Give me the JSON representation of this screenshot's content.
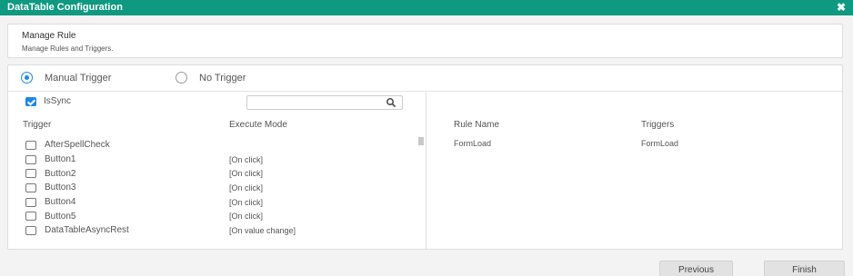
{
  "dialog": {
    "title": "DataTable Configuration",
    "close": "✖"
  },
  "rule": {
    "heading": "Manage Rule",
    "subheading": "Manage Rules and Triggers."
  },
  "trigger_type": {
    "options": [
      {
        "label": "Manual Trigger",
        "selected": true
      },
      {
        "label": "No Trigger",
        "selected": false
      }
    ]
  },
  "sync": {
    "label": "IsSync",
    "checked": true
  },
  "search": {
    "value": "",
    "placeholder": ""
  },
  "trigger_table": {
    "headers": {
      "trigger": "Trigger",
      "mode": "Execute Mode"
    },
    "rows": [
      {
        "name": "AfterSpellCheck",
        "mode": "",
        "checked": false
      },
      {
        "name": "Button1",
        "mode": "[On click]",
        "checked": false
      },
      {
        "name": "Button2",
        "mode": "[On click]",
        "checked": false
      },
      {
        "name": "Button3",
        "mode": "[On click]",
        "checked": false
      },
      {
        "name": "Button4",
        "mode": "[On click]",
        "checked": false
      },
      {
        "name": "Button5",
        "mode": "[On click]",
        "checked": false
      },
      {
        "name": "DataTableAsyncRest",
        "mode": "[On value change]",
        "checked": false
      }
    ]
  },
  "rules_table": {
    "headers": {
      "rule_name": "Rule Name",
      "triggers": "Triggers"
    },
    "rows": [
      {
        "rule_name": "FormLoad",
        "triggers": "FormLoad"
      }
    ]
  },
  "footer": {
    "previous": "Previous",
    "finish": "Finish"
  },
  "colors": {
    "header": "#0f9980",
    "accent": "#1e88e5"
  }
}
